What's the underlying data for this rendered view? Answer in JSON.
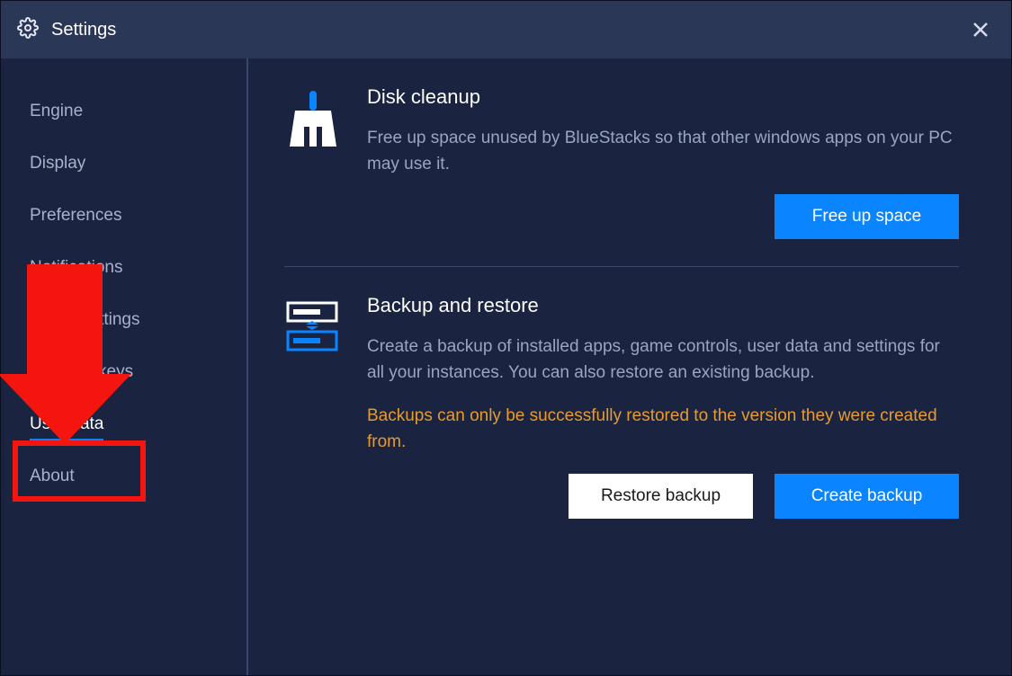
{
  "header": {
    "title": "Settings"
  },
  "sidebar": {
    "items": [
      {
        "label": "Engine",
        "active": false
      },
      {
        "label": "Display",
        "active": false
      },
      {
        "label": "Preferences",
        "active": false
      },
      {
        "label": "Notifications",
        "active": false
      },
      {
        "label": "Game settings",
        "active": false
      },
      {
        "label": "Shortcut keys",
        "active": false
      },
      {
        "label": "User data",
        "active": true
      },
      {
        "label": "About",
        "active": false
      }
    ]
  },
  "main": {
    "disk_cleanup": {
      "title": "Disk cleanup",
      "description": "Free up space unused by BlueStacks so that other windows apps on your PC may use it.",
      "button": "Free up space"
    },
    "backup_restore": {
      "title": "Backup and restore",
      "description": "Create a backup of installed apps, game controls, user data and settings for all your instances. You can also restore an existing backup.",
      "warning": "Backups can only be successfully restored to the version they were created from.",
      "restore_button": "Restore backup",
      "create_button": "Create backup"
    }
  },
  "colors": {
    "accent": "#0a84ff",
    "warning": "#e79b2d",
    "annotation": "#f3150e"
  }
}
